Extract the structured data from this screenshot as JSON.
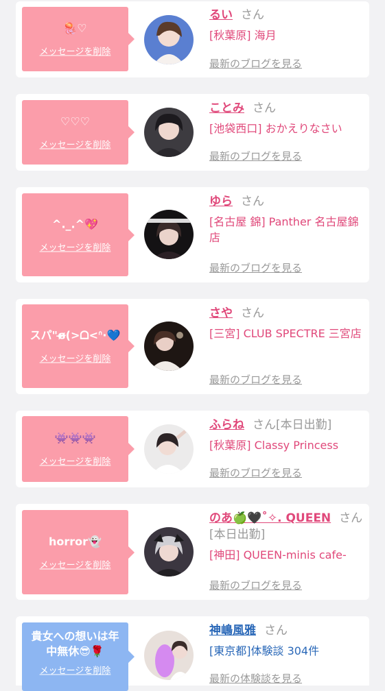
{
  "entries": [
    {
      "name": "るい",
      "honorific": "さん",
      "status": "",
      "store": "[秋葉原] 海月",
      "message": "🪼♡",
      "delete_label": "メッセージを削除",
      "blog_link": "最新のブログを見る",
      "bubble_color": "#fb9daa"
    },
    {
      "name": "ことみ",
      "honorific": "さん",
      "status": "",
      "store": "[池袋西口] おかえりなさい",
      "message": "♡♡♡",
      "delete_label": "メッセージを削除",
      "blog_link": "最新のブログを見る",
      "bubble_color": "#fb9daa"
    },
    {
      "name": "ゆら",
      "honorific": "さん",
      "status": "",
      "store": "[名古屋 錦] Panther 名古屋錦店",
      "message": "^._.^💖",
      "delete_label": "メッセージを削除",
      "blog_link": "最新のブログを見る",
      "bubble_color": "#fb9daa"
    },
    {
      "name": "さや",
      "honorific": "さん",
      "status": "",
      "store": "[三宮] CLUB SPECTRE 三宮店",
      "message": "スパ\"ɞ̴̶̷(>ᗝ<ᐢ·💙",
      "delete_label": "メッセージを削除",
      "blog_link": "最新のブログを見る",
      "bubble_color": "#fb9daa"
    },
    {
      "name": "ふらね",
      "honorific": "さん",
      "status": "[本日出勤]",
      "store": "[秋葉原] Classy Princess",
      "message": "👾👾👾",
      "delete_label": "メッセージを削除",
      "blog_link": "最新のブログを見る",
      "bubble_color": "#fb9daa"
    },
    {
      "name": "のあ🍏🖤˚✧. QUEEN",
      "honorific": "さん",
      "status": "[本日出勤]",
      "store": "[神田] QUEEN-minis cafe-",
      "message": "horror👻",
      "delete_label": "メッセージを削除",
      "blog_link": "最新のブログを見る",
      "bubble_color": "#fb9daa"
    },
    {
      "name": "神嶋風雅",
      "honorific": "さん",
      "status": "",
      "store": "[東京都]体験談 304件",
      "message": "貴女への想いは年中無休😎🌹",
      "delete_label": "メッセージを削除",
      "blog_link": "最新の体験談を見る",
      "bubble_color": "#8db6f2"
    }
  ],
  "colors": {
    "name_pink": "#e0487a",
    "name_blue": "#2a68b8",
    "muted_gray": "#999999",
    "page_bg": "#f2f2f4"
  },
  "avatar_icons": [
    "avatar-rui",
    "avatar-kotomi",
    "avatar-yura",
    "avatar-saya",
    "avatar-furane",
    "avatar-noa",
    "avatar-kamishima"
  ]
}
